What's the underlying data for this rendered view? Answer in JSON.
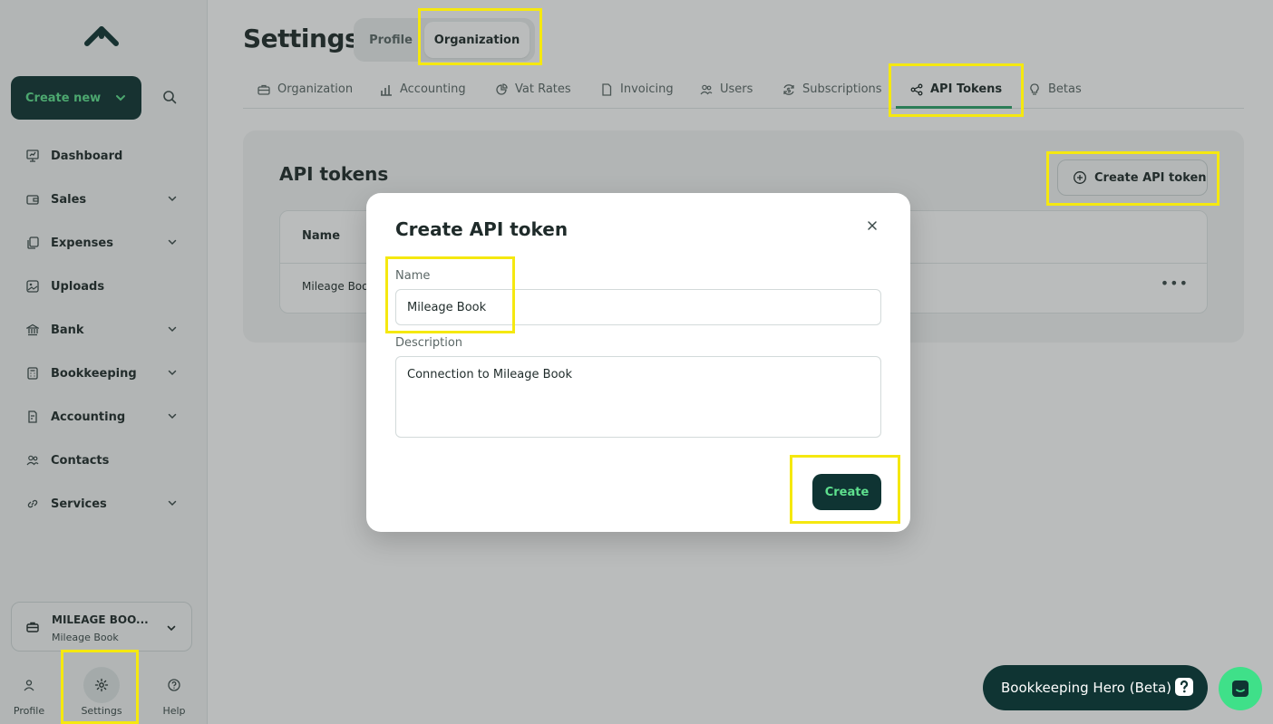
{
  "sidebar": {
    "create_new_label": "Create new",
    "items": [
      {
        "label": "Dashboard",
        "icon": "dashboard-icon",
        "has_chevron": false
      },
      {
        "label": "Sales",
        "icon": "wallet-icon",
        "has_chevron": true
      },
      {
        "label": "Expenses",
        "icon": "copy-icon",
        "has_chevron": true
      },
      {
        "label": "Uploads",
        "icon": "image-upload-icon",
        "has_chevron": false
      },
      {
        "label": "Bank",
        "icon": "bank-icon",
        "has_chevron": true
      },
      {
        "label": "Bookkeeping",
        "icon": "calculator-icon",
        "has_chevron": true
      },
      {
        "label": "Accounting",
        "icon": "ledger-icon",
        "has_chevron": true
      },
      {
        "label": "Contacts",
        "icon": "users-icon",
        "has_chevron": false
      },
      {
        "label": "Services",
        "icon": "link-icon",
        "has_chevron": true
      }
    ],
    "org": {
      "name": "MILEAGE BOO...",
      "subtitle": "Mileage Book"
    },
    "bottom": {
      "profile": "Profile",
      "settings": "Settings",
      "help": "Help"
    }
  },
  "header": {
    "title": "Settings",
    "segments": {
      "profile": "Profile",
      "organization": "Organization"
    }
  },
  "tabs": [
    {
      "label": "Organization",
      "icon": "briefcase-icon"
    },
    {
      "label": "Accounting",
      "icon": "bar-chart-icon"
    },
    {
      "label": "Vat Rates",
      "icon": "pie-chart-icon"
    },
    {
      "label": "Invoicing",
      "icon": "document-icon"
    },
    {
      "label": "Users",
      "icon": "users-icon"
    },
    {
      "label": "Subscriptions",
      "icon": "refresh-dollar-icon"
    },
    {
      "label": "API Tokens",
      "icon": "share-icon",
      "active": true
    },
    {
      "label": "Betas",
      "icon": "lightbulb-icon"
    }
  ],
  "card": {
    "title": "API tokens",
    "create_button": "Create API token",
    "table": {
      "header_name": "Name",
      "row_name": "Mileage Boo"
    }
  },
  "modal": {
    "title": "Create API token",
    "name_label": "Name",
    "name_value": "Mileage Book",
    "description_label": "Description",
    "description_value": "Connection to Mileage Book",
    "create_button": "Create"
  },
  "widgets": {
    "hero_label": "Bookkeeping Hero (Beta)"
  },
  "colors": {
    "brand_dark": "#0f3433",
    "brand_green": "#5ee08e",
    "highlight": "#f5e810"
  }
}
